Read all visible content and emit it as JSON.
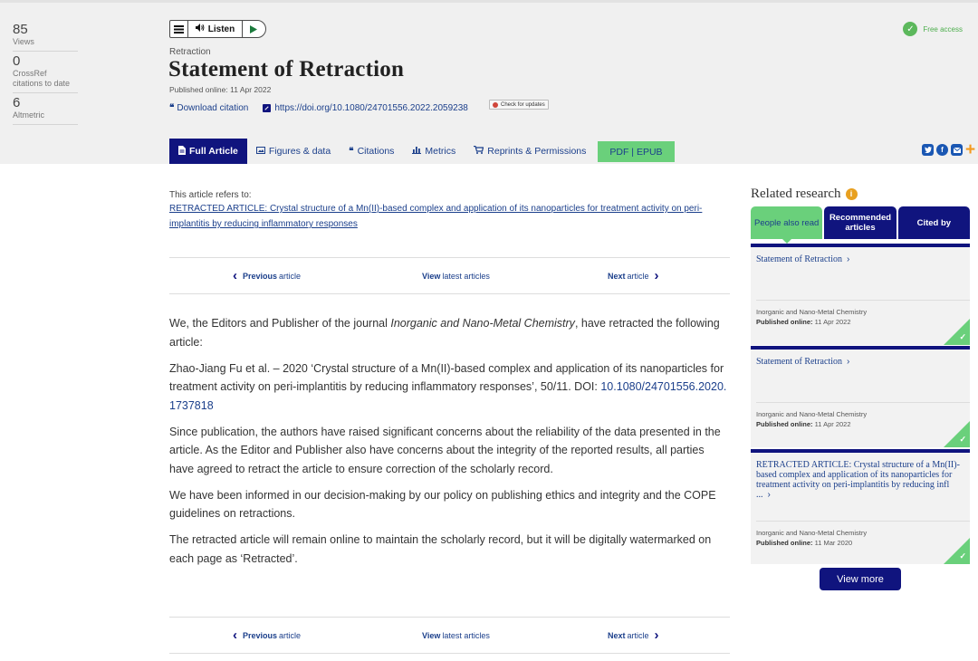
{
  "metrics": [
    {
      "value": "85",
      "label": "Views"
    },
    {
      "value": "0",
      "label": "CrossRef citations to date"
    },
    {
      "value": "6",
      "label": "Altmetric"
    }
  ],
  "listen": {
    "label": "Listen"
  },
  "article": {
    "type": "Retraction",
    "title": "Statement of Retraction",
    "published": "Published online: 11 Apr 2022",
    "download_citation": "Download citation",
    "doi_link": "https://doi.org/10.1080/24701556.2022.2059238",
    "check_updates": "Check for updates"
  },
  "access": {
    "label": "Free access"
  },
  "tabs": [
    {
      "label": "Full Article",
      "icon": "document-icon",
      "active": true
    },
    {
      "label": "Figures & data",
      "icon": "image-icon"
    },
    {
      "label": "Citations",
      "icon": "quote-icon"
    },
    {
      "label": "Metrics",
      "icon": "bar-chart-icon"
    },
    {
      "label": "Reprints & Permissions",
      "icon": "cart-icon"
    },
    {
      "label": "PDF | EPUB"
    }
  ],
  "share": [
    "twitter-icon",
    "facebook-icon",
    "email-icon",
    "plus-icon"
  ],
  "refers": {
    "label": "This article refers to:",
    "link": "RETRACTED ARTICLE: Crystal structure of a Mn(II)-based complex and application of its nanoparticles for treatment activity on peri-implantitis by reducing inflammatory responses"
  },
  "article_nav": {
    "prev_bold": "Previous",
    "prev_rest": "article",
    "latest_bold": "View",
    "latest_rest": "latest articles",
    "next_bold": "Next",
    "next_rest": "article"
  },
  "body": {
    "p1_a": "We, the Editors and Publisher of the journal ",
    "p1_journal": "Inorganic and Nano-Metal Chemistry",
    "p1_b": ", have retracted the following article:",
    "p2_a": "Zhao-Jiang Fu et al. – 2020 ‘Crystal structure of a Mn(II)-based complex and application of its nanoparticles for treatment activity on peri-implantitis by reducing inflammatory responses’, 50/11. DOI: ",
    "p2_doi": "10.1080/24701556.2020.1737818",
    "p3": "Since publication, the authors have raised significant concerns about the reliability of the data presented in the article. As the Editor and Publisher also have concerns about the integrity of the reported results, all parties have agreed to retract the article to ensure correction of the scholarly record.",
    "p4": "We have been informed in our decision-making by our policy on publishing ethics and integrity and the COPE guidelines on retractions.",
    "p5": "The retracted article will remain online to maintain the scholarly record, but it will be digitally watermarked on each page as ‘Retracted’."
  },
  "related": {
    "title": "Related research",
    "tabs": [
      "People also read",
      "Recommended articles",
      "Cited by"
    ],
    "cards": [
      {
        "title": "Statement of Retraction",
        "journal": "Inorganic and Nano-Metal Chemistry",
        "pub_label": "Published online:",
        "pub_date": "11 Apr 2022"
      },
      {
        "title": "Statement of Retraction",
        "journal": "Inorganic and Nano-Metal Chemistry",
        "pub_label": "Published online:",
        "pub_date": "11 Apr 2022"
      },
      {
        "title": "RETRACTED ARTICLE: Crystal structure of a Mn(II)-based complex and application of its nanoparticles for treatment activity on peri-implantitis by reducing infl ...",
        "journal": "Inorganic and Nano-Metal Chemistry",
        "pub_label": "Published online:",
        "pub_date": "11 Mar 2020"
      }
    ],
    "view_more": "View more"
  },
  "colors": {
    "navy": "#10147e",
    "green": "#6ad07b",
    "link": "#1b3f8b"
  }
}
